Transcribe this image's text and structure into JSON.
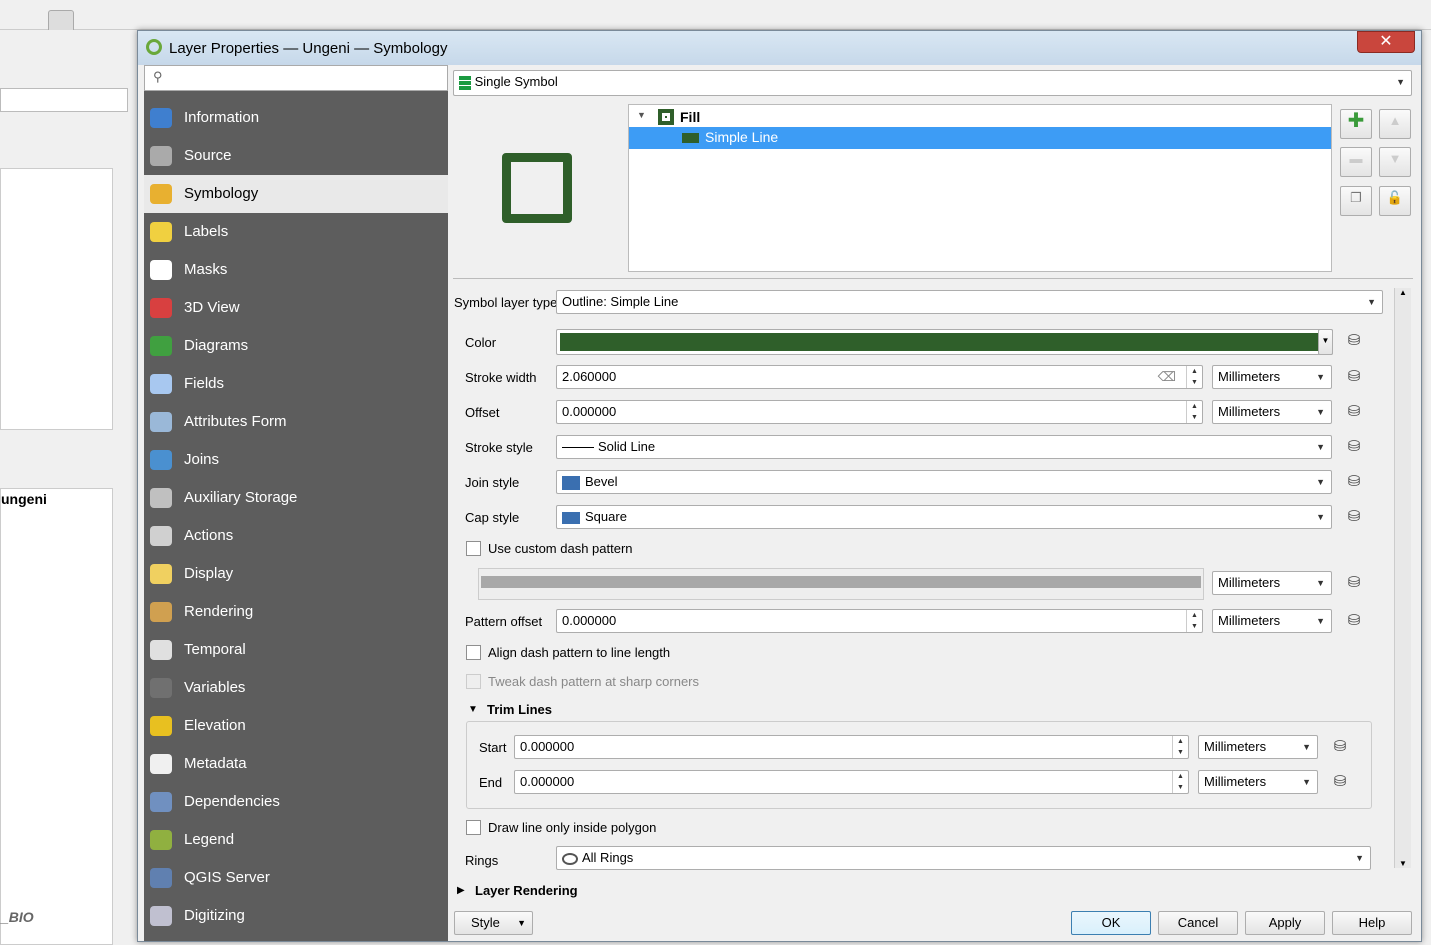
{
  "dialog": {
    "title": "Layer Properties — Ungeni — Symbology",
    "close_icon": "close-icon"
  },
  "background": {
    "layer_name": "ungeni",
    "layer_bottom": "_BIO"
  },
  "sidebar": {
    "search_placeholder": "",
    "items": [
      {
        "label": "Information",
        "icon": "info-icon",
        "color": "#3f7fcf"
      },
      {
        "label": "Source",
        "icon": "source-icon",
        "color": "#aaaaaa"
      },
      {
        "label": "Symbology",
        "icon": "symbology-icon",
        "color": "#e8b030",
        "selected": true
      },
      {
        "label": "Labels",
        "icon": "labels-icon",
        "color": "#f0d040"
      },
      {
        "label": "Masks",
        "icon": "masks-icon",
        "color": "#ffffff"
      },
      {
        "label": "3D View",
        "icon": "3d-view-icon",
        "color": "#d84040"
      },
      {
        "label": "Diagrams",
        "icon": "diagrams-icon",
        "color": "#40a040"
      },
      {
        "label": "Fields",
        "icon": "fields-icon",
        "color": "#a8c8f0"
      },
      {
        "label": "Attributes Form",
        "icon": "attributes-form-icon",
        "color": "#9ab8d8"
      },
      {
        "label": "Joins",
        "icon": "joins-icon",
        "color": "#4a90d0"
      },
      {
        "label": "Auxiliary Storage",
        "icon": "auxiliary-storage-icon",
        "color": "#c0c0c0"
      },
      {
        "label": "Actions",
        "icon": "actions-icon",
        "color": "#d0d0d0"
      },
      {
        "label": "Display",
        "icon": "display-icon",
        "color": "#f0d060"
      },
      {
        "label": "Rendering",
        "icon": "rendering-icon",
        "color": "#d0a050"
      },
      {
        "label": "Temporal",
        "icon": "temporal-icon",
        "color": "#e0e0e0"
      },
      {
        "label": "Variables",
        "icon": "variables-icon",
        "color": "#707070"
      },
      {
        "label": "Elevation",
        "icon": "elevation-icon",
        "color": "#e8c020"
      },
      {
        "label": "Metadata",
        "icon": "metadata-icon",
        "color": "#f0f0f0"
      },
      {
        "label": "Dependencies",
        "icon": "dependencies-icon",
        "color": "#7090c0"
      },
      {
        "label": "Legend",
        "icon": "legend-icon",
        "color": "#90b040"
      },
      {
        "label": "QGIS Server",
        "icon": "qgis-server-icon",
        "color": "#6080b0"
      },
      {
        "label": "Digitizing",
        "icon": "digitizing-icon",
        "color": "#c0c0d0"
      }
    ]
  },
  "renderer": {
    "value": "Single Symbol"
  },
  "symbol_tree": {
    "root": "Fill",
    "child": "Simple Line"
  },
  "colors": {
    "symbol": "#2f5f2a",
    "selection": "#3d9cf5"
  },
  "props": {
    "symbol_layer_type_label": "Symbol layer type",
    "symbol_layer_type": "Outline: Simple Line",
    "color_label": "Color",
    "stroke_width_label": "Stroke width",
    "stroke_width": "2.060000",
    "stroke_width_unit": "Millimeters",
    "offset_label": "Offset",
    "offset": "0.000000",
    "offset_unit": "Millimeters",
    "stroke_style_label": "Stroke style",
    "stroke_style": "Solid Line",
    "join_style_label": "Join style",
    "join_style": "Bevel",
    "cap_style_label": "Cap style",
    "cap_style": "Square",
    "custom_dash_label": "Use custom dash pattern",
    "dash_unit": "Millimeters",
    "pattern_offset_label": "Pattern offset",
    "pattern_offset": "0.000000",
    "pattern_offset_unit": "Millimeters",
    "align_dash_label": "Align dash pattern to line length",
    "tweak_dash_label": "Tweak dash pattern at sharp corners",
    "trim_lines_label": "Trim Lines",
    "start_label": "Start",
    "start": "0.000000",
    "start_unit": "Millimeters",
    "end_label": "End",
    "end": "0.000000",
    "end_unit": "Millimeters",
    "draw_inside_label": "Draw line only inside polygon",
    "rings_label": "Rings",
    "rings": "All Rings",
    "layer_rendering_label": "Layer Rendering"
  },
  "footer": {
    "style": "Style",
    "ok": "OK",
    "cancel": "Cancel",
    "apply": "Apply",
    "help": "Help"
  }
}
